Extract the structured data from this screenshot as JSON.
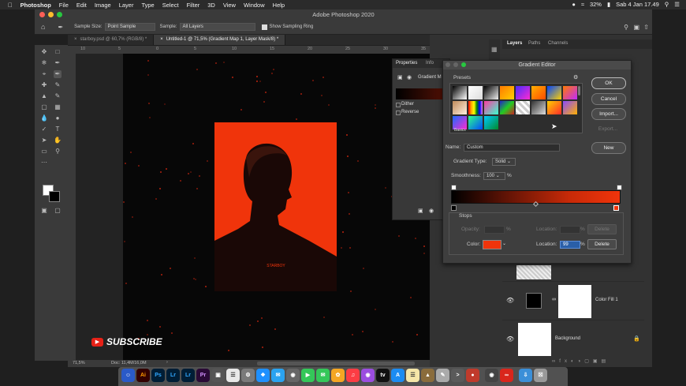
{
  "menubar": {
    "app_name": "Photoshop",
    "menus": [
      "File",
      "Edit",
      "Image",
      "Layer",
      "Type",
      "Select",
      "Filter",
      "3D",
      "View",
      "Window",
      "Help"
    ],
    "battery": "32%",
    "clock": "Sab 4 Jan  17.49"
  },
  "window": {
    "title": "Adobe Photoshop 2020"
  },
  "options": {
    "sample_size_label": "Sample Size:",
    "sample_size_value": "Point Sample",
    "sample_label": "Sample:",
    "sample_value": "All Layers",
    "show_ring_label": "Show Sampling Ring"
  },
  "tabs": [
    {
      "label": "starboy.psd @ 60,7% (RGB/8) *"
    },
    {
      "label": "Untitled-1 @ 71,5% (Gradient Map 1, Layer Mask/8) *"
    }
  ],
  "ruler": {
    "ticks": [
      "10",
      "5",
      "0",
      "5",
      "10",
      "15",
      "20",
      "25",
      "30",
      "35"
    ]
  },
  "canvas": {
    "poster_color": "#f0340b",
    "poster_text": "STARBOY",
    "subscribe_text": "SUBSCRIBE"
  },
  "status": {
    "zoom": "71,5%",
    "doc": "Doc: 11,4M/16,0M"
  },
  "panels": {
    "tabs": [
      "Layers",
      "Paths",
      "Channels"
    ]
  },
  "properties": {
    "tabs": [
      "Properties",
      "Info"
    ],
    "title": "Gradient M",
    "dither_label": "Dither",
    "reverse_label": "Reverse"
  },
  "layers": [
    {
      "name": "Color Fill 1"
    },
    {
      "name": "Background"
    }
  ],
  "gradient_editor": {
    "title": "Gradient Editor",
    "presets_label": "Presets",
    "basics_label": "Basics",
    "buttons": {
      "ok": "OK",
      "cancel": "Cancel",
      "import": "Import...",
      "export": "Export...",
      "new": "New"
    },
    "name_label": "Name:",
    "name_value": "Custom",
    "gradient_type_label": "Gradient Type:",
    "gradient_type_value": "Solid",
    "smoothness_label": "Smoothness:",
    "smoothness_value": "100",
    "smoothness_unit": "%",
    "stops_label": "Stops",
    "opacity_label": "Opacity:",
    "opacity_unit": "%",
    "location_label": "Location:",
    "location_unit": "%",
    "delete_label": "Delete",
    "color_label": "Color:",
    "color_location_value": "99",
    "stop_color": "#f0340b"
  },
  "watermark": "SUBSCRIBE"
}
